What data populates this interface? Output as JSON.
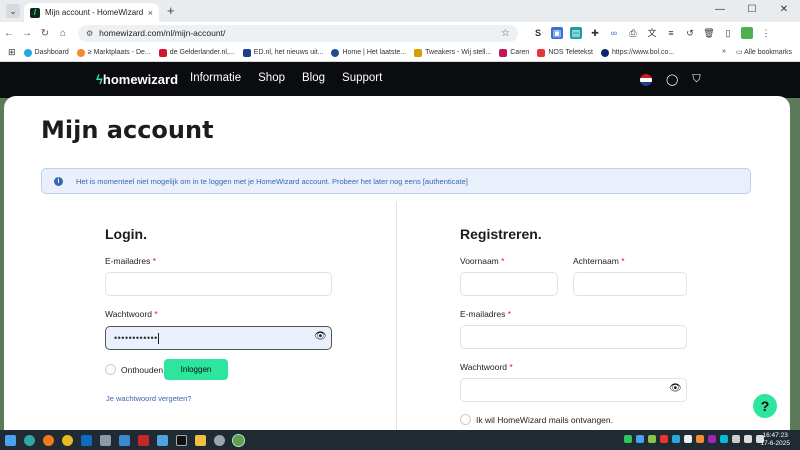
{
  "browser": {
    "tab_title": "Mijn account - HomeWizard",
    "tab_close": "×",
    "new_tab": "+",
    "url": "homewizard.com/nl/mijn-account/",
    "bookmarks": [
      "Dashboard",
      "≥ Marktplaats - De...",
      "de Gelderlander.nl,...",
      "ED.nl, het nieuws uit...",
      "Home | Het laatste...",
      "Tweakers - Wij stell...",
      "Caren",
      "NOS Teletekst",
      "https://www.bol.co..."
    ],
    "all_bookmarks": "Alle bookmarks"
  },
  "site": {
    "logo": "homewizard",
    "nav": [
      "Informatie",
      "Shop",
      "Blog",
      "Support"
    ]
  },
  "page": {
    "title": "Mijn account",
    "alert": "Het is momenteel niet mogelijk om in te loggen met je HomeWizard account. Probeer het later nog eens [authenticate]"
  },
  "login": {
    "title": "Login.",
    "email_label": "E-mailadres",
    "email_value": "                                                                ",
    "password_label": "Wachtwoord",
    "password_value": "••••••••••••",
    "remember_label": "Onthouden",
    "submit_label": "Inloggen",
    "forgot_label": "Je wachtwoord vergeten?"
  },
  "register": {
    "title": "Registreren.",
    "firstname_label": "Voornaam",
    "lastname_label": "Achternaam",
    "email_label": "E-mailadres",
    "password_label": "Wachtwoord",
    "newsletter_label": "Ik wil HomeWizard mails ontvangen."
  },
  "help_label": "?",
  "clock": {
    "time": "16:47:23",
    "date": "17-6-2025"
  },
  "colors": {
    "accent": "#2ee59d",
    "header_bg": "#0b0c10",
    "alert_text": "#3a66b0",
    "required": "#d0182b"
  }
}
